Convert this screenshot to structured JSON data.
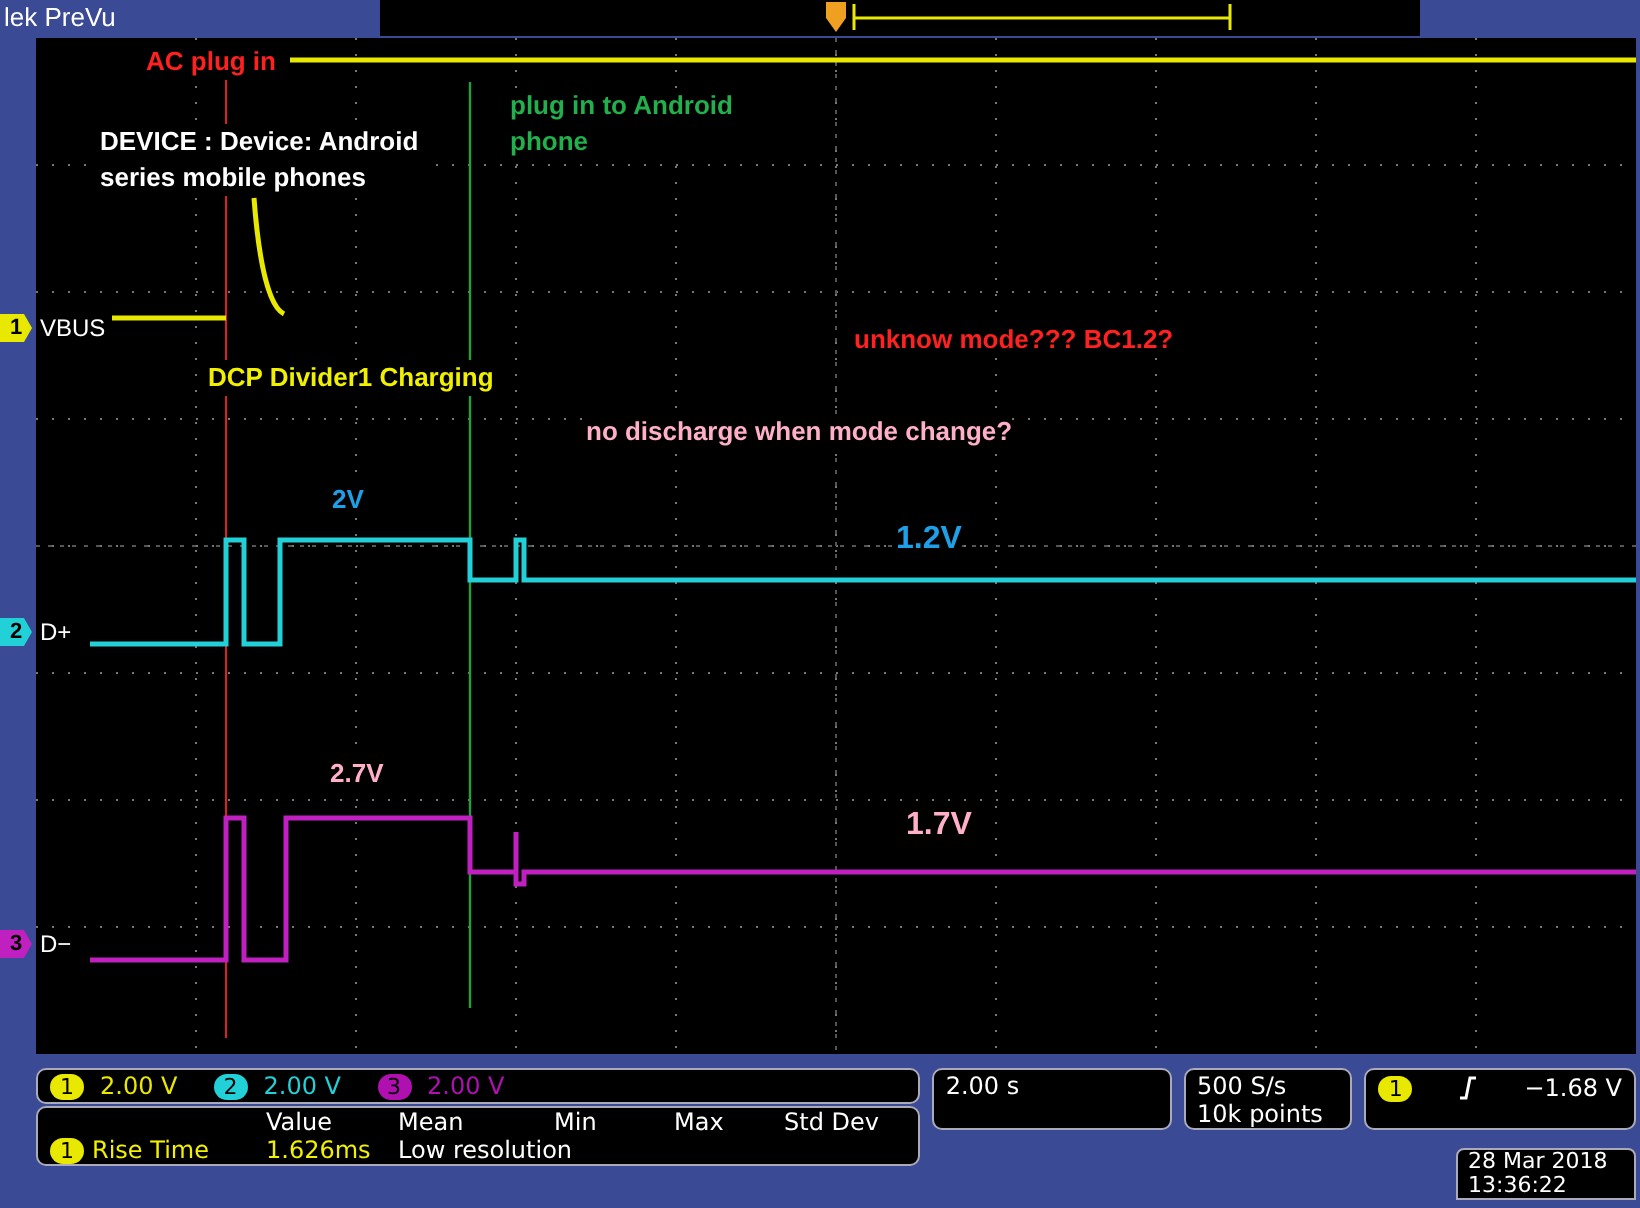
{
  "header": {
    "title": "lek PreVu"
  },
  "channels": [
    {
      "number": "1",
      "label": "VBUS",
      "color": "#e8e800"
    },
    {
      "number": "2",
      "label": "D+",
      "color": "#22d0d8"
    },
    {
      "number": "3",
      "label": "D−",
      "color": "#c020c0"
    }
  ],
  "annotations": [
    {
      "text": "AC plug in",
      "color": "#ff2020"
    },
    {
      "text": "DEVICE : Device: Android series mobile phones",
      "color": "#ffffff"
    },
    {
      "text": "plug in to Android phone",
      "color": "#22b04c"
    },
    {
      "text": "DCP Divider1 Charging",
      "color": "#f0f000"
    },
    {
      "text": "unknow mode??? BC1.2?",
      "color": "#ff2020"
    },
    {
      "text": "no discharge when mode change?",
      "color": "#ffb0c8"
    },
    {
      "text": "2V",
      "color": "#1ea0e8"
    },
    {
      "text": "1.2V",
      "color": "#1ea0e8"
    },
    {
      "text": "2.7V",
      "color": "#ffb0c8"
    },
    {
      "text": "1.7V",
      "color": "#ffb0c8"
    }
  ],
  "vertical": [
    {
      "number": "1",
      "scale": "2.00 V",
      "color": "#e8e800"
    },
    {
      "number": "2",
      "scale": "2.00 V",
      "color": "#22d0d8"
    },
    {
      "number": "3",
      "scale": "2.00 V",
      "color": "#b010b0"
    }
  ],
  "measurement": {
    "headers": [
      "Value",
      "Mean",
      "Min",
      "Max",
      "Std Dev"
    ],
    "channel": "1",
    "name": "Rise Time",
    "value": "1.626ms",
    "mean": "Low resolution"
  },
  "timebase": "2.00 s",
  "acquisition": {
    "rate": "500 S/s",
    "points": "10k points"
  },
  "trigger": {
    "channel": "1",
    "level": "−1.68 V"
  },
  "date": "28 Mar 2018",
  "time": "13:36:22"
}
